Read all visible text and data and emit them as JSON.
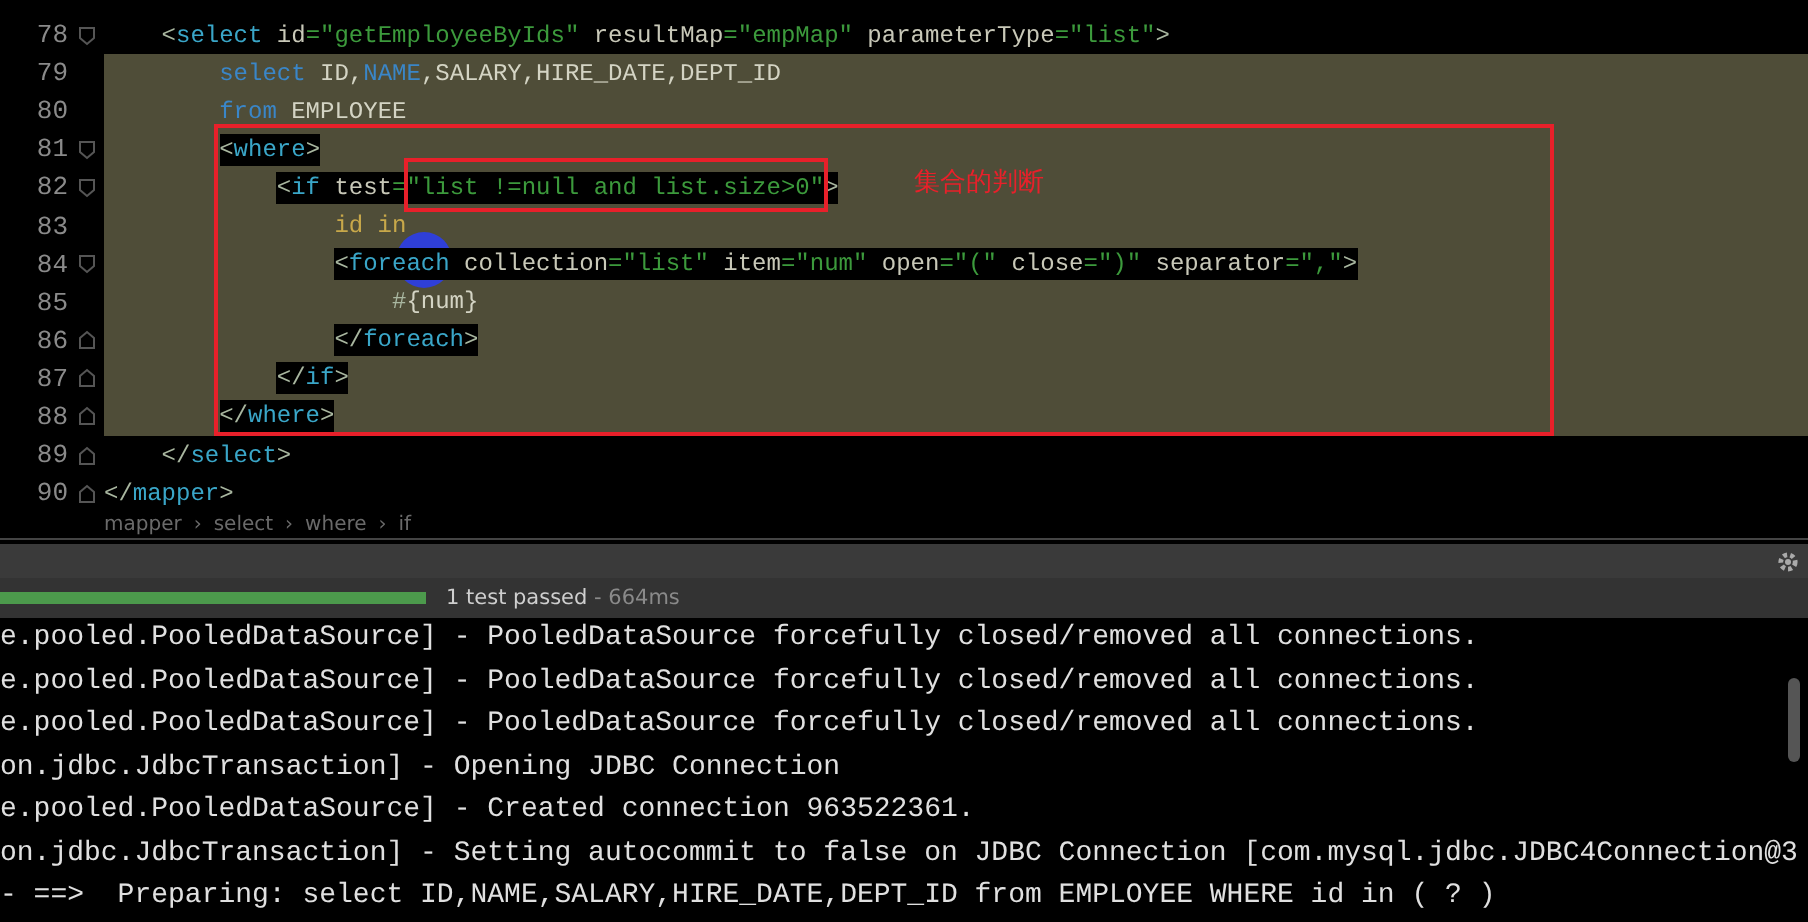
{
  "editor": {
    "lines": [
      {
        "number": "78",
        "kind": "open",
        "selected": false,
        "tokens": [
          {
            "kind": "bracket",
            "text": "<"
          },
          {
            "kind": "tag",
            "text": "select"
          },
          {
            "kind": "attr",
            "text": " id"
          },
          {
            "kind": "eq",
            "text": "="
          },
          {
            "kind": "str",
            "text": "\"getEmployeeByIds\""
          },
          {
            "kind": "attr",
            "text": " resultMap"
          },
          {
            "kind": "eq",
            "text": "="
          },
          {
            "kind": "str",
            "text": "\"empMap\""
          },
          {
            "kind": "attr",
            "text": " parameterType"
          },
          {
            "kind": "eq",
            "text": "="
          },
          {
            "kind": "str",
            "text": "\"list\""
          },
          {
            "kind": "bracket",
            "text": ">"
          }
        ],
        "children": [
          {
            "number": "79",
            "selected": true,
            "highlight": false,
            "tokens": [
              {
                "kind": "kw",
                "text": "select"
              },
              {
                "kind": "text",
                "text": " ID,"
              },
              {
                "kind": "kw",
                "text": "NAME"
              },
              {
                "kind": "text",
                "text": ",SALARY,HIRE_DATE,DEPT_ID"
              }
            ]
          },
          {
            "number": "80",
            "selected": true,
            "highlight": false,
            "tokens": [
              {
                "kind": "kw",
                "text": "from"
              },
              {
                "kind": "text",
                "text": " EMPLOYEE"
              }
            ]
          },
          {
            "number": "81",
            "kind": "open",
            "selected": true,
            "highlight": true,
            "tokens": [
              {
                "kind": "bracket",
                "text": "<"
              },
              {
                "kind": "tag",
                "text": "where"
              },
              {
                "kind": "bracket",
                "text": ">"
              }
            ],
            "children": [
              {
                "number": "82",
                "kind": "open",
                "selected": true,
                "highlight": true,
                "tokens": [
                  {
                    "kind": "bracket",
                    "text": "<"
                  },
                  {
                    "kind": "tag",
                    "text": "if"
                  },
                  {
                    "kind": "attr",
                    "text": " test"
                  },
                  {
                    "kind": "eq",
                    "text": "="
                  },
                  {
                    "kind": "str",
                    "text": "\"list !=null and list.size>0\""
                  },
                  {
                    "kind": "bracket",
                    "text": ">"
                  }
                ],
                "children": [
                  {
                    "number": "83",
                    "selected": true,
                    "highlight": false,
                    "tokens": [
                      {
                        "kind": "var",
                        "text": "id in"
                      }
                    ]
                  },
                  {
                    "number": "84",
                    "kind": "open",
                    "selected": true,
                    "highlight": true,
                    "tokens": [
                      {
                        "kind": "bracket",
                        "text": "<"
                      },
                      {
                        "kind": "tag",
                        "text": "foreach"
                      },
                      {
                        "kind": "attr",
                        "text": " collection"
                      },
                      {
                        "kind": "eq",
                        "text": "="
                      },
                      {
                        "kind": "str",
                        "text": "\"list\""
                      },
                      {
                        "kind": "attr",
                        "text": " item"
                      },
                      {
                        "kind": "eq",
                        "text": "="
                      },
                      {
                        "kind": "str",
                        "text": "\"num\""
                      },
                      {
                        "kind": "attr",
                        "text": " open"
                      },
                      {
                        "kind": "eq",
                        "text": "="
                      },
                      {
                        "kind": "str",
                        "text": "\"(\""
                      },
                      {
                        "kind": "attr",
                        "text": " close"
                      },
                      {
                        "kind": "eq",
                        "text": "="
                      },
                      {
                        "kind": "str",
                        "text": "\")\""
                      },
                      {
                        "kind": "attr",
                        "text": " separator"
                      },
                      {
                        "kind": "eq",
                        "text": "="
                      },
                      {
                        "kind": "str",
                        "text": "\",\""
                      },
                      {
                        "kind": "bracket",
                        "text": ">"
                      }
                    ],
                    "children": [
                      {
                        "number": "85",
                        "selected": true,
                        "highlight": false,
                        "tokens": [
                          {
                            "kind": "bracket",
                            "text": "#"
                          },
                          {
                            "kind": "text",
                            "text": "{num}"
                          }
                        ]
                      }
                    ]
                  },
                  {
                    "number": "86",
                    "kind": "close",
                    "selected": true,
                    "highlight": true,
                    "tokens": [
                      {
                        "kind": "bracket",
                        "text": "</"
                      },
                      {
                        "kind": "tag",
                        "text": "foreach"
                      },
                      {
                        "kind": "bracket",
                        "text": ">"
                      }
                    ]
                  }
                ]
              },
              {
                "number": "87",
                "kind": "close",
                "selected": true,
                "highlight": true,
                "tokens": [
                  {
                    "kind": "bracket",
                    "text": "</"
                  },
                  {
                    "kind": "tag",
                    "text": "if"
                  },
                  {
                    "kind": "bracket",
                    "text": ">"
                  }
                ]
              }
            ]
          },
          {
            "number": "88",
            "kind": "close",
            "selected": true,
            "highlight": true,
            "tokens": [
              {
                "kind": "bracket",
                "text": "</"
              },
              {
                "kind": "tag",
                "text": "where"
              },
              {
                "kind": "bracket",
                "text": ">"
              }
            ]
          }
        ]
      },
      {
        "number": "89",
        "kind": "close",
        "selected": false,
        "tokens": [
          {
            "kind": "bracket",
            "text": "</"
          },
          {
            "kind": "tag",
            "text": "select"
          },
          {
            "kind": "bracket",
            "text": ">"
          }
        ]
      }
    ],
    "outer_lines": [
      {
        "number": "90",
        "kind": "close",
        "selected": false,
        "tokens": [
          {
            "kind": "bracket",
            "text": "</"
          },
          {
            "kind": "tag",
            "text": "mapper"
          },
          {
            "kind": "bracket",
            "text": ">"
          }
        ]
      }
    ],
    "annotation": "集合的判断",
    "breadcrumb": {
      "separator": "›",
      "items": [
        "mapper",
        "select",
        "where",
        "if"
      ]
    }
  },
  "test_bar": {
    "level": 1,
    "status": "1 test passed",
    "duration": " - 664ms"
  },
  "console": {
    "lines": [
      "e.pooled.PooledDataSource] - PooledDataSource forcefully closed/removed all connections.",
      "e.pooled.PooledDataSource] - PooledDataSource forcefully closed/removed all connections.",
      "e.pooled.PooledDataSource] - PooledDataSource forcefully closed/removed all connections.",
      "on.jdbc.JdbcTransaction] - Opening JDBC Connection",
      "e.pooled.PooledDataSource] - Created connection 963522361.",
      "on.jdbc.JdbcTransaction] - Setting autocommit to false on JDBC Connection [com.mysql.jdbc.JDBC4Connection@3",
      "- ==>  Preparing: select ID,NAME,SALARY,HIRE_DATE,DEPT_ID from EMPLOYEE WHERE id in ( ? )"
    ]
  }
}
